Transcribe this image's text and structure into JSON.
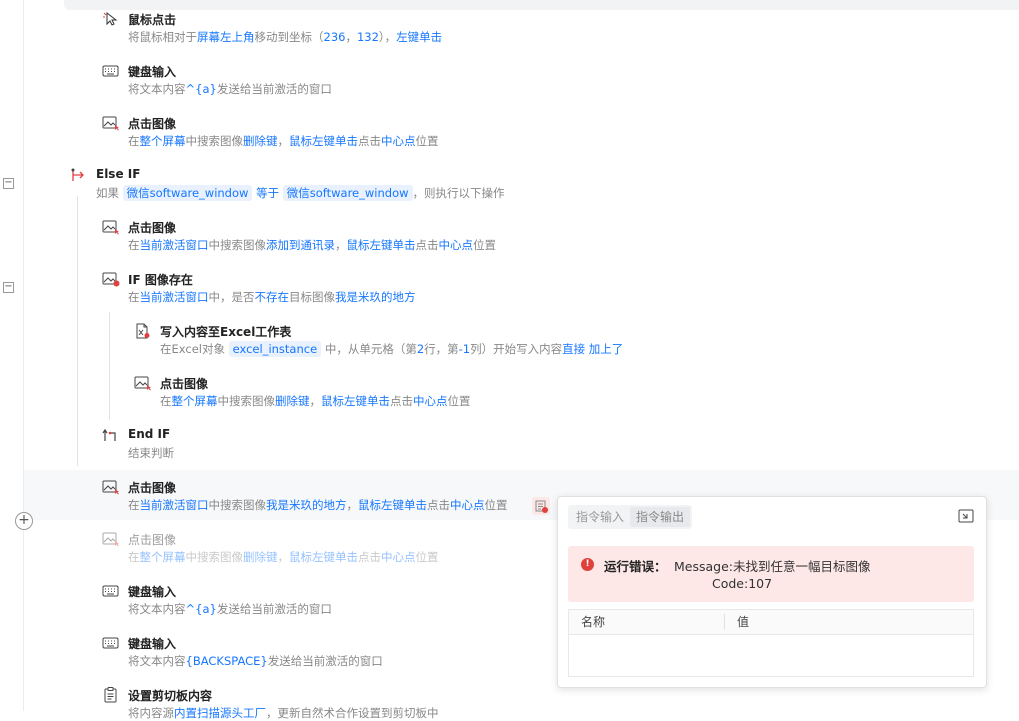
{
  "steps": [
    {
      "title": "鼠标点击",
      "desc": [
        "将鼠标相对于",
        {
          "k": "屏幕左上角"
        },
        "移动到坐标（",
        {
          "k": "236"
        },
        "，",
        {
          "k": "132"
        },
        "），",
        {
          "k": "左键单击"
        }
      ]
    },
    {
      "title": "键盘输入",
      "desc": [
        "将文本内容",
        {
          "k": "^{a}"
        },
        "发送给当前激活的窗口"
      ]
    },
    {
      "title": "点击图像",
      "desc": [
        "在",
        {
          "k": "整个屏幕"
        },
        "中搜索图像",
        {
          "k": "删除键"
        },
        "，",
        {
          "k": "鼠标左键单击"
        },
        "点击",
        {
          "k": "中心点"
        },
        "位置"
      ]
    },
    {
      "title": "Else IF",
      "desc": [
        "如果 ",
        {
          "t": "微信software_window"
        },
        " ",
        {
          "k": "等于"
        },
        " ",
        {
          "t": "微信software_window"
        },
        "，则执行以下操作"
      ]
    },
    {
      "title": "点击图像",
      "desc": [
        "在",
        {
          "k": "当前激活窗口"
        },
        "中搜索图像",
        {
          "k": "添加到通讯录"
        },
        "，",
        {
          "k": "鼠标左键单击"
        },
        "点击",
        {
          "k": "中心点"
        },
        "位置"
      ]
    },
    {
      "title": "IF 图像存在",
      "desc": [
        "在",
        {
          "k": "当前激活窗口"
        },
        "中，是否",
        {
          "k": "不存在"
        },
        "目标图像",
        {
          "k": "我是米玖的地方"
        }
      ]
    },
    {
      "title": "写入内容至Excel工作表",
      "desc": [
        "在Excel对象 ",
        {
          "t": "excel_instance"
        },
        " 中，从单元格（第",
        {
          "k": "2"
        },
        "行，第",
        {
          "k": "-1"
        },
        "列）开始写入内容",
        {
          "k": "直接 加上了"
        }
      ]
    },
    {
      "title": "点击图像",
      "desc": [
        "在",
        {
          "k": "整个屏幕"
        },
        "中搜索图像",
        {
          "k": "删除键"
        },
        "，",
        {
          "k": "鼠标左键单击"
        },
        "点击",
        {
          "k": "中心点"
        },
        "位置"
      ]
    },
    {
      "title": "End IF",
      "desc": [
        "结束判断"
      ]
    },
    {
      "title": "点击图像",
      "desc": [
        "在",
        {
          "k": "当前激活窗口"
        },
        "中搜索图像",
        {
          "k": "我是米玖的地方"
        },
        "，",
        {
          "k": "鼠标左键单击"
        },
        "点击",
        {
          "k": "中心点"
        },
        "位置"
      ]
    },
    {
      "title": "点击图像",
      "desc": [
        "在",
        {
          "k": "整个屏幕"
        },
        "中搜索图像",
        {
          "k": "删除键"
        },
        "，",
        {
          "k": "鼠标左键单击"
        },
        "点击",
        {
          "k": "中心点"
        },
        "位置"
      ]
    },
    {
      "title": "键盘输入",
      "desc": [
        "将文本内容",
        {
          "k": "^{a}"
        },
        "发送给当前激活的窗口"
      ]
    },
    {
      "title": "键盘输入",
      "desc": [
        "将文本内容",
        {
          "k": "{BACKSPACE}"
        },
        "发送给当前激活的窗口"
      ]
    },
    {
      "title": "设置剪切板内容",
      "desc": [
        "将内容源",
        {
          "k": "内置扫描源头工厂"
        },
        "，更新自然术合作设置到剪切板中"
      ]
    }
  ],
  "panel": {
    "tabs": [
      "指令输入",
      "指令输出"
    ],
    "error_label": "运行错误：",
    "error_message": "Message:未找到任意一幅目标图像",
    "error_code": "Code:107",
    "table_headers": [
      "名称",
      "值"
    ]
  }
}
